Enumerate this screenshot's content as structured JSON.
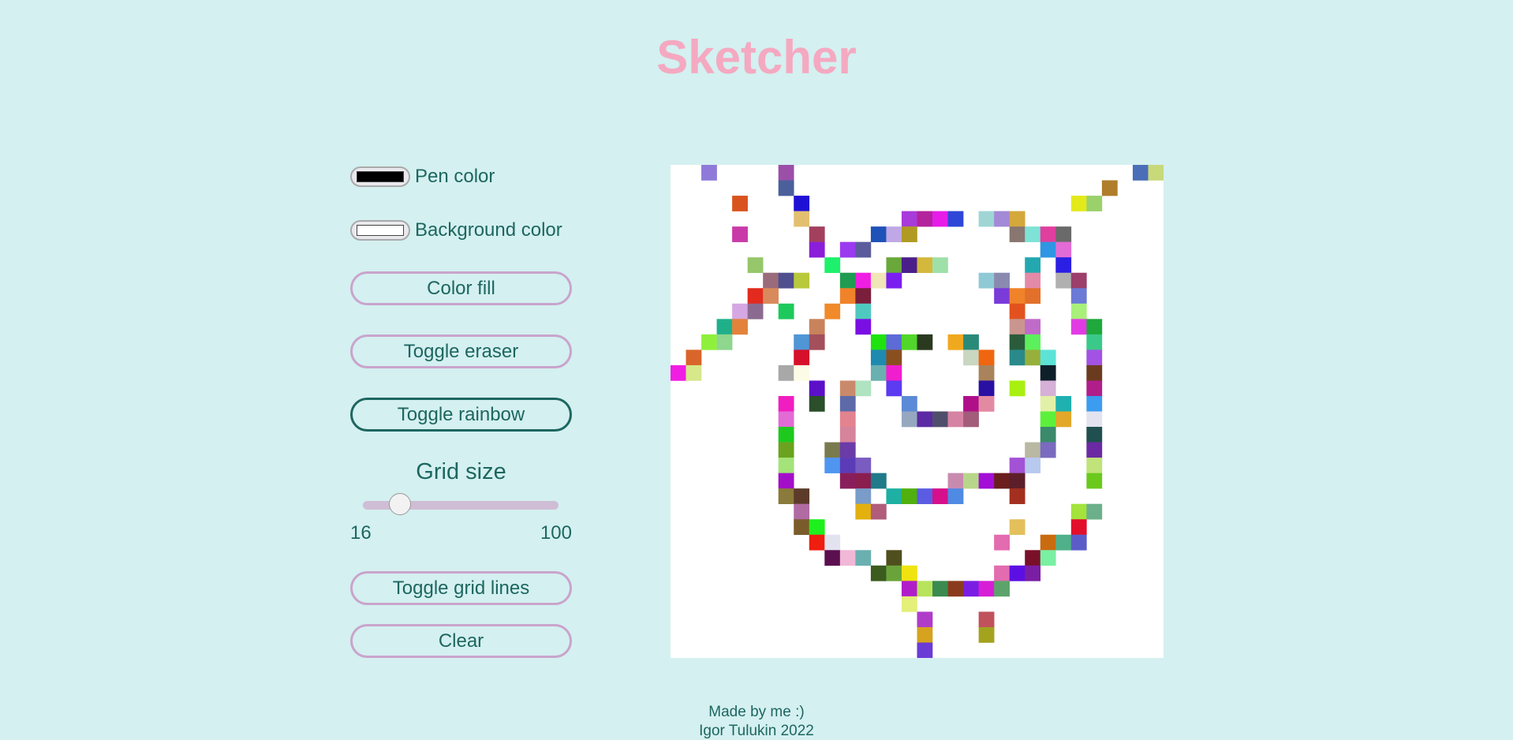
{
  "app": {
    "title": "Sketcher"
  },
  "controls": {
    "pen_color": {
      "label": "Pen color",
      "value": "#000000"
    },
    "background_color": {
      "label": "Background color",
      "value": "#ffffff"
    },
    "color_fill": "Color fill",
    "toggle_eraser": "Toggle eraser",
    "toggle_rainbow": "Toggle rainbow",
    "rainbow_active": true,
    "grid_size": {
      "label": "Grid size",
      "min": "16",
      "max": "100",
      "value": 32
    },
    "toggle_grid_lines": "Toggle grid lines",
    "clear": "Clear"
  },
  "canvas": {
    "grid": 32,
    "pixels": [
      [
        2,
        0,
        "#8f7ad9"
      ],
      [
        7,
        0,
        "#9b4fa8"
      ],
      [
        30,
        0,
        "#4a6fb8"
      ],
      [
        31,
        0,
        "#c8d97a"
      ],
      [
        7,
        1,
        "#4b5f9c"
      ],
      [
        28,
        1,
        "#b07d2a"
      ],
      [
        4,
        2,
        "#d9531e"
      ],
      [
        8,
        2,
        "#1f10d6"
      ],
      [
        26,
        2,
        "#e3ea1a"
      ],
      [
        27,
        2,
        "#9ad16b"
      ],
      [
        8,
        3,
        "#e3c070"
      ],
      [
        15,
        3,
        "#a83bd9"
      ],
      [
        16,
        3,
        "#b3239c"
      ],
      [
        17,
        3,
        "#e61ce8"
      ],
      [
        18,
        3,
        "#2e47d9"
      ],
      [
        20,
        3,
        "#9fd6d4"
      ],
      [
        21,
        3,
        "#a389d6"
      ],
      [
        22,
        3,
        "#d4a83b"
      ],
      [
        4,
        4,
        "#c93ba8"
      ],
      [
        9,
        4,
        "#a3405e"
      ],
      [
        13,
        4,
        "#1f52b8"
      ],
      [
        14,
        4,
        "#c0a8e6"
      ],
      [
        15,
        4,
        "#b09a22"
      ],
      [
        22,
        4,
        "#8a7670"
      ],
      [
        23,
        4,
        "#7ee3d6"
      ],
      [
        24,
        4,
        "#e03f9f"
      ],
      [
        25,
        4,
        "#6a6a6a"
      ],
      [
        9,
        5,
        "#8a1ed9"
      ],
      [
        11,
        5,
        "#9a3bf0"
      ],
      [
        12,
        5,
        "#5c5c9c"
      ],
      [
        24,
        5,
        "#2e96e3"
      ],
      [
        25,
        5,
        "#e36bd6"
      ],
      [
        5,
        6,
        "#96c76b"
      ],
      [
        10,
        6,
        "#1ef06b"
      ],
      [
        14,
        6,
        "#6aa83b"
      ],
      [
        15,
        6,
        "#4a1f8a"
      ],
      [
        16,
        6,
        "#d4b83b"
      ],
      [
        17,
        6,
        "#9fe0a8"
      ],
      [
        23,
        6,
        "#23a8b0"
      ],
      [
        25,
        6,
        "#2a1fe3"
      ],
      [
        6,
        7,
        "#9a6b7a"
      ],
      [
        7,
        7,
        "#4f4f8f"
      ],
      [
        8,
        7,
        "#b8c93b"
      ],
      [
        11,
        7,
        "#1f9c52"
      ],
      [
        12,
        7,
        "#f01ee3"
      ],
      [
        13,
        7,
        "#f0e6b8"
      ],
      [
        14,
        7,
        "#7a1ff0"
      ],
      [
        20,
        7,
        "#8fc9d6"
      ],
      [
        21,
        7,
        "#8a8ab0"
      ],
      [
        23,
        7,
        "#e38aa8"
      ],
      [
        25,
        7,
        "#b0b0b0"
      ],
      [
        26,
        7,
        "#9c3f6b"
      ],
      [
        5,
        8,
        "#e32a1e"
      ],
      [
        6,
        8,
        "#d98a5c"
      ],
      [
        11,
        8,
        "#f0832a"
      ],
      [
        12,
        8,
        "#7a1f3b"
      ],
      [
        21,
        8,
        "#7a3bd9"
      ],
      [
        22,
        8,
        "#f0832a"
      ],
      [
        23,
        8,
        "#e3702a"
      ],
      [
        26,
        8,
        "#6b7ad6"
      ],
      [
        4,
        9,
        "#d6a8e3"
      ],
      [
        5,
        9,
        "#8a6b8f"
      ],
      [
        7,
        9,
        "#1ec95c"
      ],
      [
        10,
        9,
        "#f08a2a"
      ],
      [
        12,
        9,
        "#4fc9c0"
      ],
      [
        22,
        9,
        "#e3521e"
      ],
      [
        26,
        9,
        "#a8f07a"
      ],
      [
        3,
        10,
        "#1fb08a"
      ],
      [
        4,
        10,
        "#e3833b"
      ],
      [
        9,
        10,
        "#c9835c"
      ],
      [
        12,
        10,
        "#7a0fe3"
      ],
      [
        22,
        10,
        "#c9968f"
      ],
      [
        23,
        10,
        "#c06bc9"
      ],
      [
        26,
        10,
        "#e33be3"
      ],
      [
        27,
        10,
        "#1fa83b"
      ],
      [
        2,
        11,
        "#8ff03b"
      ],
      [
        3,
        11,
        "#8fd68f"
      ],
      [
        8,
        11,
        "#4f96d6"
      ],
      [
        9,
        11,
        "#a34f5c"
      ],
      [
        13,
        11,
        "#1ee30f"
      ],
      [
        14,
        11,
        "#5c6bd6"
      ],
      [
        15,
        11,
        "#52d62a"
      ],
      [
        16,
        11,
        "#2a3a1f"
      ],
      [
        18,
        11,
        "#f0a81e"
      ],
      [
        19,
        11,
        "#2a8a7a"
      ],
      [
        22,
        11,
        "#2a5c3b"
      ],
      [
        23,
        11,
        "#5cf05c"
      ],
      [
        27,
        11,
        "#3bc98a"
      ],
      [
        1,
        12,
        "#d9652a"
      ],
      [
        8,
        12,
        "#d60f2a"
      ],
      [
        13,
        12,
        "#1f8ab0"
      ],
      [
        14,
        12,
        "#8a4f1f"
      ],
      [
        19,
        12,
        "#c9d6c0"
      ],
      [
        20,
        12,
        "#f0650f"
      ],
      [
        22,
        12,
        "#2a8a8a"
      ],
      [
        23,
        12,
        "#96b03b"
      ],
      [
        24,
        12,
        "#5ce3d6"
      ],
      [
        27,
        12,
        "#a352e3"
      ],
      [
        0,
        13,
        "#f01ee3"
      ],
      [
        1,
        13,
        "#d6e88a"
      ],
      [
        7,
        13,
        "#a8a8a8"
      ],
      [
        8,
        13,
        "#fcfce6"
      ],
      [
        13,
        13,
        "#6bb0b0"
      ],
      [
        14,
        13,
        "#f01ecf"
      ],
      [
        20,
        13,
        "#a8835c"
      ],
      [
        24,
        13,
        "#0f1f2a"
      ],
      [
        27,
        13,
        "#6b3b1f"
      ],
      [
        9,
        14,
        "#5c0fc9"
      ],
      [
        11,
        14,
        "#c98a6b"
      ],
      [
        12,
        14,
        "#b0e3c0"
      ],
      [
        14,
        14,
        "#5c3bf0"
      ],
      [
        20,
        14,
        "#2a0fa3"
      ],
      [
        22,
        14,
        "#a8f00f"
      ],
      [
        24,
        14,
        "#d6b0d6"
      ],
      [
        27,
        14,
        "#b01e8a"
      ],
      [
        7,
        15,
        "#f01ec0"
      ],
      [
        9,
        15,
        "#2a4f2a"
      ],
      [
        11,
        15,
        "#5c6ba8"
      ],
      [
        15,
        15,
        "#5c8ad6"
      ],
      [
        19,
        15,
        "#b00f8a"
      ],
      [
        20,
        15,
        "#e38aa3"
      ],
      [
        24,
        15,
        "#e3f0a8"
      ],
      [
        25,
        15,
        "#1fb0b0"
      ],
      [
        27,
        15,
        "#3b9cf0"
      ],
      [
        7,
        16,
        "#e36bd6"
      ],
      [
        11,
        16,
        "#e3838f"
      ],
      [
        15,
        16,
        "#96a8c0"
      ],
      [
        16,
        16,
        "#5c2aa3"
      ],
      [
        17,
        16,
        "#4f4f6b"
      ],
      [
        18,
        16,
        "#d683a3"
      ],
      [
        19,
        16,
        "#a35c7a"
      ],
      [
        24,
        16,
        "#5cf03b"
      ],
      [
        25,
        16,
        "#e3a82a"
      ],
      [
        27,
        16,
        "#e3e3f0"
      ],
      [
        7,
        17,
        "#1ec91e"
      ],
      [
        11,
        17,
        "#d6839c"
      ],
      [
        24,
        17,
        "#3b8a6b"
      ],
      [
        27,
        17,
        "#1f4f4f"
      ],
      [
        7,
        18,
        "#6ba31e"
      ],
      [
        10,
        18,
        "#7a7a4f"
      ],
      [
        11,
        18,
        "#6b3ba8"
      ],
      [
        23,
        18,
        "#b8b8a3"
      ],
      [
        24,
        18,
        "#7a6bc0"
      ],
      [
        27,
        18,
        "#6b2aa3"
      ],
      [
        7,
        19,
        "#a3e37a"
      ],
      [
        10,
        19,
        "#4f96f0"
      ],
      [
        11,
        19,
        "#5c3bb8"
      ],
      [
        12,
        19,
        "#7a5cc0"
      ],
      [
        22,
        19,
        "#a352d6"
      ],
      [
        23,
        19,
        "#b8c9f0"
      ],
      [
        27,
        19,
        "#c0e37a"
      ],
      [
        7,
        20,
        "#a30fc9"
      ],
      [
        11,
        20,
        "#8a1e5c"
      ],
      [
        12,
        20,
        "#8a1e4f"
      ],
      [
        13,
        20,
        "#1f7a8a"
      ],
      [
        18,
        20,
        "#c98ab0"
      ],
      [
        19,
        20,
        "#b8d68a"
      ],
      [
        20,
        20,
        "#a30fd6"
      ],
      [
        21,
        20,
        "#6b1e1e"
      ],
      [
        22,
        20,
        "#5c1f2a"
      ],
      [
        27,
        20,
        "#6bc91e"
      ],
      [
        7,
        21,
        "#8a7a3b"
      ],
      [
        8,
        21,
        "#5c3b2a"
      ],
      [
        12,
        21,
        "#7a9cc9"
      ],
      [
        14,
        21,
        "#1eb0a3"
      ],
      [
        15,
        21,
        "#4fb00f"
      ],
      [
        16,
        21,
        "#5c5ce3"
      ],
      [
        17,
        21,
        "#d60f8a"
      ],
      [
        18,
        21,
        "#4f8ae3"
      ],
      [
        22,
        21,
        "#a3301e"
      ],
      [
        8,
        22,
        "#b06ba3"
      ],
      [
        12,
        22,
        "#e3b00f"
      ],
      [
        13,
        22,
        "#b05c7a"
      ],
      [
        26,
        22,
        "#a3e33b"
      ],
      [
        27,
        22,
        "#6bb08a"
      ],
      [
        8,
        23,
        "#7a5c2a"
      ],
      [
        9,
        23,
        "#1ef01e"
      ],
      [
        22,
        23,
        "#e3c05c"
      ],
      [
        26,
        23,
        "#e30f2a"
      ],
      [
        9,
        24,
        "#f01e0f"
      ],
      [
        10,
        24,
        "#e3e3f0"
      ],
      [
        21,
        24,
        "#e36bb0"
      ],
      [
        24,
        24,
        "#c96b0f"
      ],
      [
        25,
        24,
        "#4fb08a"
      ],
      [
        26,
        24,
        "#5c5cc9"
      ],
      [
        10,
        25,
        "#5c0f4f"
      ],
      [
        11,
        25,
        "#f0b8d6"
      ],
      [
        12,
        25,
        "#6bb0b0"
      ],
      [
        14,
        25,
        "#4f4f1e"
      ],
      [
        23,
        25,
        "#7a0f2a"
      ],
      [
        24,
        25,
        "#7af0a3"
      ],
      [
        13,
        26,
        "#3b5c1e"
      ],
      [
        14,
        26,
        "#6ba33b"
      ],
      [
        15,
        26,
        "#f0e30f"
      ],
      [
        21,
        26,
        "#e36bb0"
      ],
      [
        22,
        26,
        "#5c0fe3"
      ],
      [
        23,
        26,
        "#7a1ea3"
      ],
      [
        15,
        27,
        "#b01ec9"
      ],
      [
        16,
        27,
        "#b8e35c"
      ],
      [
        17,
        27,
        "#3b8a4f"
      ],
      [
        18,
        27,
        "#8a3b1e"
      ],
      [
        19,
        27,
        "#7a1ee3"
      ],
      [
        20,
        27,
        "#d61ed6"
      ],
      [
        21,
        27,
        "#5ca36b"
      ],
      [
        15,
        28,
        "#e3f07a"
      ],
      [
        16,
        29,
        "#b03bc9"
      ],
      [
        20,
        29,
        "#c0525c"
      ],
      [
        16,
        30,
        "#d6a31e"
      ],
      [
        20,
        30,
        "#a3a31e"
      ],
      [
        16,
        31,
        "#6b3bd6"
      ]
    ]
  },
  "footer": {
    "line1": "Made by me :)",
    "line2": "Igor Tulukin 2022"
  }
}
